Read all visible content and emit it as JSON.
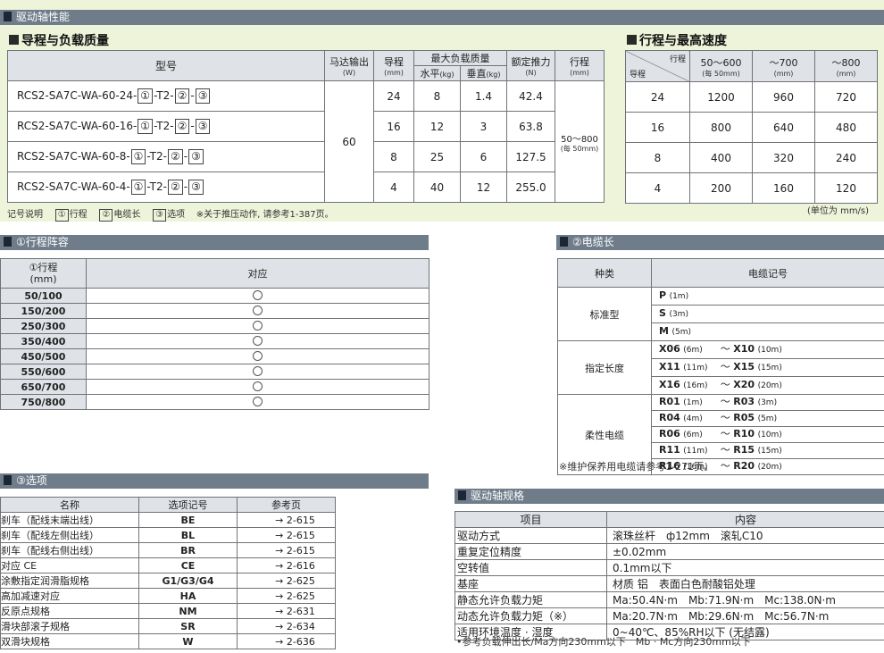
{
  "drive_section": {
    "title": "驱动轴性能"
  },
  "lead_table": {
    "title": "导程与负载质量",
    "headers": {
      "model": "型号",
      "motor": "马达输出",
      "motor_unit": "(W)",
      "lead": "导程",
      "lead_unit": "(mm)",
      "maxload": "最大负载质量",
      "horizontal": "水平",
      "horizontal_unit": "(kg)",
      "vertical": "垂直",
      "vertical_unit": "(kg)",
      "thrust": "额定推力",
      "thrust_unit": "(N)",
      "stroke": "行程",
      "stroke_unit": "(mm)"
    },
    "motor_value": "60",
    "stroke_value": "50～800",
    "stroke_pitch": "(每 50mm)",
    "sep": "-",
    "rows": [
      {
        "model_prefix": "RCS2-SA7C-WA-60-24-",
        "m1": "①",
        "m2": "-T2-",
        "m3": "②",
        "m4": "③",
        "lead": "24",
        "h": "8",
        "v": "1.4",
        "thrust": "42.4"
      },
      {
        "model_prefix": "RCS2-SA7C-WA-60-16-",
        "m1": "①",
        "m2": "-T2-",
        "m3": "②",
        "m4": "③",
        "lead": "16",
        "h": "12",
        "v": "3",
        "thrust": "63.8"
      },
      {
        "model_prefix": "RCS2-SA7C-WA-60-8-",
        "m1": "①",
        "m2": "-T2-",
        "m3": "②",
        "m4": "③",
        "lead": "8",
        "h": "25",
        "v": "6",
        "thrust": "127.5"
      },
      {
        "model_prefix": "RCS2-SA7C-WA-60-4-",
        "m1": "①",
        "m2": "-T2-",
        "m3": "②",
        "m4": "③",
        "lead": "4",
        "h": "40",
        "v": "12",
        "thrust": "255.0"
      }
    ]
  },
  "speed_table": {
    "title": "行程与最高速度",
    "stroke_label": "行程",
    "lead_label": "导程",
    "cols": [
      {
        "label": "50～600",
        "sub": "(每 50mm)"
      },
      {
        "label": "～700",
        "sub": "(mm)"
      },
      {
        "label": "～800",
        "sub": "(mm)"
      }
    ],
    "rows": [
      [
        "24",
        "1200",
        "960",
        "720"
      ],
      [
        "16",
        "800",
        "640",
        "480"
      ],
      [
        "8",
        "400",
        "320",
        "240"
      ],
      [
        "4",
        "200",
        "160",
        "120"
      ]
    ],
    "unit": "(单位为 mm/s)"
  },
  "legend": {
    "label": "记号说明",
    "k1": "①",
    "v1": "行程",
    "k2": "②",
    "v2": "电缆长",
    "k3": "③",
    "v3": "选项",
    "note": "※关于推压动作, 请参考1-387页。"
  },
  "stroke_lineup": {
    "title": "①行程阵容",
    "h1": "①行程",
    "h1_unit": "(mm)",
    "h2": "对应",
    "rows": [
      "50/100",
      "150/200",
      "250/300",
      "350/400",
      "450/500",
      "550/600",
      "650/700",
      "750/800"
    ]
  },
  "cable": {
    "title": "②电缆长",
    "h1": "种类",
    "h2": "电缆记号",
    "groups": [
      {
        "name": "标准型",
        "items": [
          {
            "a": "P",
            "a_len": "(1m)"
          },
          {
            "a": "S",
            "a_len": "(3m)"
          },
          {
            "a": "M",
            "a_len": "(5m)"
          }
        ]
      },
      {
        "name": "指定长度",
        "items": [
          {
            "a": "X06",
            "a_len": "(6m)",
            "b": "X10",
            "b_len": "(10m)"
          },
          {
            "a": "X11",
            "a_len": "(11m)",
            "b": "X15",
            "b_len": "(15m)"
          },
          {
            "a": "X16",
            "a_len": "(16m)",
            "b": "X20",
            "b_len": "(20m)"
          }
        ]
      },
      {
        "name": "柔性电缆",
        "items": [
          {
            "a": "R01",
            "a_len": "(1m)",
            "b": "R03",
            "b_len": "(3m)"
          },
          {
            "a": "R04",
            "a_len": "(4m)",
            "b": "R05",
            "b_len": "(5m)"
          },
          {
            "a": "R06",
            "a_len": "(6m)",
            "b": "R10",
            "b_len": "(10m)"
          },
          {
            "a": "R11",
            "a_len": "(11m)",
            "b": "R15",
            "b_len": "(15m)"
          },
          {
            "a": "R16",
            "a_len": "(16m)",
            "b": "R20",
            "b_len": "(20m)"
          }
        ]
      }
    ],
    "tilde": "～",
    "note": "※维护保养用电缆请参考1-271页。"
  },
  "options": {
    "title": "③选项",
    "h1": "名称",
    "h2": "选项记号",
    "h3": "参考页",
    "rows": [
      [
        "刹车（配线末端出线）",
        "BE",
        "→ 2-615"
      ],
      [
        "刹车（配线左侧出线）",
        "BL",
        "→ 2-615"
      ],
      [
        "刹车（配线右侧出线）",
        "BR",
        "→ 2-615"
      ],
      [
        "对应 CE",
        "CE",
        "→ 2-616"
      ],
      [
        "涂敷指定润滑脂规格",
        "G1/G3/G4",
        "→ 2-625"
      ],
      [
        "高加减速对应",
        "HA",
        "→ 2-625"
      ],
      [
        "反原点规格",
        "NM",
        "→ 2-631"
      ],
      [
        "滑块部滚子规格",
        "SR",
        "→ 2-634"
      ],
      [
        "双滑块规格",
        "W",
        "→ 2-636"
      ]
    ]
  },
  "spec": {
    "title": "驱动轴规格",
    "h1": "项目",
    "h2": "内容",
    "rows": [
      [
        "驱动方式",
        "滚珠丝杆　ф12mm　滚轧C10"
      ],
      [
        "重复定位精度",
        "±0.02mm"
      ],
      [
        "空转值",
        "0.1mm以下"
      ],
      [
        "基座",
        "材质 铝　表面白色耐酸铝处理"
      ],
      [
        "静态允许负载力矩",
        "Ma:50.4N·m　Mb:71.9N·m　Mc:138.0N·m"
      ],
      [
        "动态允许负载力矩（※）",
        "Ma:20.7N·m　Mb:29.6N·m　Mc:56.7N·m"
      ],
      [
        "适用环境温度 · 湿度",
        "0~40℃、85%RH以下 (无结露)"
      ]
    ],
    "note": "•参考负载伸出长/Ma方向230mm以下　Mb · Mc方向230mm以下"
  },
  "colors": {
    "bar": "#6f7d8b",
    "green_bg": "#eef4d9",
    "header_cell": "#dfe3e7"
  }
}
